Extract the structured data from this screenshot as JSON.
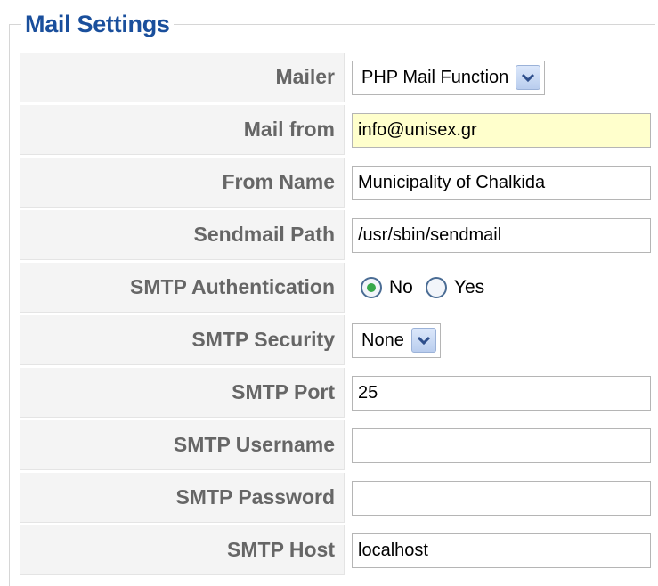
{
  "section": {
    "title": "Mail Settings"
  },
  "fields": {
    "mailer": {
      "label": "Mailer",
      "value": "PHP Mail Function"
    },
    "mail_from": {
      "label": "Mail from",
      "value": "info@unisex.gr"
    },
    "from_name": {
      "label": "From Name",
      "value": "Municipality of Chalkida"
    },
    "sendmail_path": {
      "label": "Sendmail Path",
      "value": "/usr/sbin/sendmail"
    },
    "smtp_auth": {
      "label": "SMTP Authentication",
      "options": [
        "No",
        "Yes"
      ],
      "selected": "No"
    },
    "smtp_security": {
      "label": "SMTP Security",
      "value": "None"
    },
    "smtp_port": {
      "label": "SMTP Port",
      "value": "25"
    },
    "smtp_username": {
      "label": "SMTP Username",
      "value": ""
    },
    "smtp_password": {
      "label": "SMTP Password",
      "value": ""
    },
    "smtp_host": {
      "label": "SMTP Host",
      "value": "localhost"
    }
  },
  "colors": {
    "title": "#1a4f9c",
    "label": "#666666",
    "focused_field": "#ffffcc",
    "radio_checked": "#37a84a"
  },
  "icons": {
    "dropdown": "chevron-down-icon"
  }
}
